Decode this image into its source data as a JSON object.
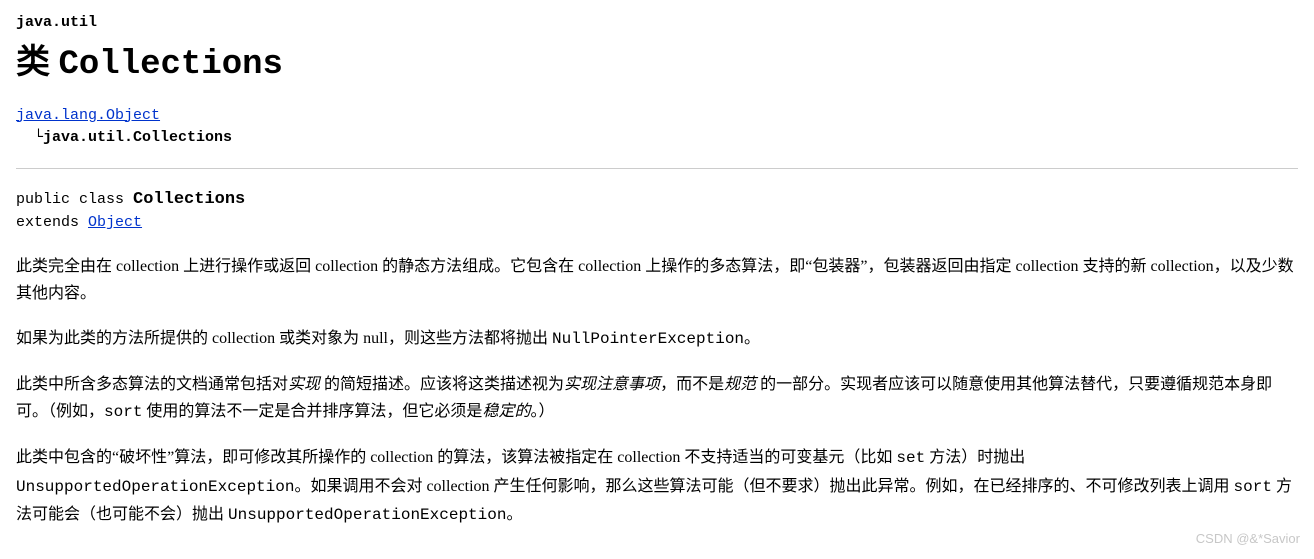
{
  "package": "java.util",
  "class_title_prefix": "类 ",
  "class_title_name": "Collections",
  "inheritance": {
    "parent": "java.lang.Object",
    "child": "java.util.Collections"
  },
  "signature": {
    "modifiers": "public class ",
    "name": "Collections",
    "extends_label": "extends ",
    "extends_link": "Object"
  },
  "para1": {
    "t1": "此类完全由在 collection 上进行操作或返回 collection 的静态方法组成。它包含在 collection 上操作的多态算法，即“包装器”，包装器返回由指定 collection 支持的新 collection，以及少数其他内容。"
  },
  "para2": {
    "t1": "如果为此类的方法所提供的 collection 或类对象为 null，则这些方法都将抛出 ",
    "code1": "NullPointerException",
    "t2": "。"
  },
  "para3": {
    "t1": "此类中所含多态算法的文档通常包括对",
    "i1": "实现",
    "t2": " 的简短描述。应该将这类描述视为",
    "i2": "实现注意事项",
    "t3": "，而不是",
    "i3": "规范",
    "t4": " 的一部分。实现者应该可以随意使用其他算法替代，只要遵循规范本身即可。（例如，",
    "code1": "sort",
    "t5": " 使用的算法不一定是合并排序算法，但它必须是",
    "i4": "稳定的",
    "t6": "。）"
  },
  "para4": {
    "t1": "此类中包含的“破坏性”算法，即可修改其所操作的 collection 的算法，该算法被指定在 collection 不支持适当的可变基元（比如 ",
    "code1": "set",
    "t2": " 方法）时抛出 ",
    "code2": "UnsupportedOperationException",
    "t3": "。如果调用不会对 collection 产生任何影响，那么这些算法可能（但不要求）抛出此异常。例如，在已经排序的、不可修改列表上调用 ",
    "code3": "sort",
    "t4": " 方法可能会（也可能不会）抛出 ",
    "code4": "UnsupportedOperationException",
    "t5": "。"
  },
  "watermark": "CSDN @&*Savior"
}
